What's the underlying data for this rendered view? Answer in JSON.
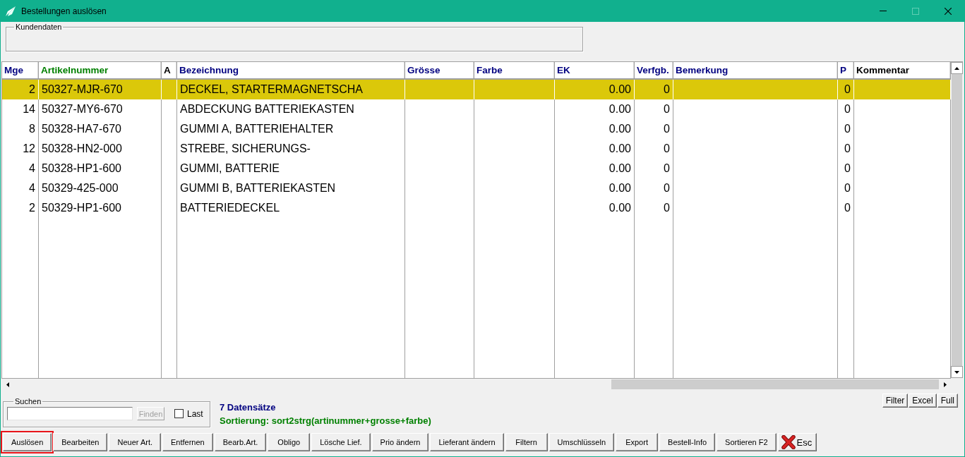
{
  "window": {
    "title": "Bestellungen auslösen",
    "controls": [
      {
        "kind": "minimize",
        "disabled": false
      },
      {
        "kind": "maximize",
        "disabled": true
      },
      {
        "kind": "close",
        "disabled": false
      }
    ]
  },
  "customer_group": {
    "label": "Kundendaten"
  },
  "table": {
    "columns": [
      {
        "label": "Mge",
        "kind": "number",
        "color": "#000080"
      },
      {
        "label": "Artikelnummer",
        "kind": "text",
        "color": "#008000"
      },
      {
        "label": "A",
        "kind": "text",
        "color": "#000000"
      },
      {
        "label": "Bezeichnung",
        "kind": "text",
        "color": "#000080"
      },
      {
        "label": "Grösse",
        "kind": "text",
        "color": "#000080"
      },
      {
        "label": "Farbe",
        "kind": "text",
        "color": "#000080"
      },
      {
        "label": "EK",
        "kind": "number",
        "color": "#000080"
      },
      {
        "label": "Verfgb.",
        "kind": "number",
        "color": "#000080"
      },
      {
        "label": "Bemerkung",
        "kind": "text",
        "color": "#000080"
      },
      {
        "label": "P",
        "kind": "number",
        "color": "#000080"
      },
      {
        "label": "Kommentar",
        "kind": "text",
        "color": "#000000"
      }
    ],
    "rows": [
      {
        "selected": true,
        "cells": [
          "2",
          "50327-MJR-670",
          null,
          "DECKEL, STARTERMAGNETSCHA",
          null,
          null,
          "0.00",
          "0",
          null,
          "0",
          null
        ]
      },
      {
        "selected": false,
        "cells": [
          "14",
          "50327-MY6-670",
          null,
          "ABDECKUNG BATTERIEKASTEN",
          null,
          null,
          "0.00",
          "0",
          null,
          "0",
          null
        ]
      },
      {
        "selected": false,
        "cells": [
          "8",
          "50328-HA7-670",
          null,
          "GUMMI A, BATTERIEHALTER",
          null,
          null,
          "0.00",
          "0",
          null,
          "0",
          null
        ]
      },
      {
        "selected": false,
        "cells": [
          "12",
          "50328-HN2-000",
          null,
          "STREBE, SICHERUNGS-",
          null,
          null,
          "0.00",
          "0",
          null,
          "0",
          null
        ]
      },
      {
        "selected": false,
        "cells": [
          "4",
          "50328-HP1-600",
          null,
          "GUMMI, BATTERIE",
          null,
          null,
          "0.00",
          "0",
          null,
          "0",
          null
        ]
      },
      {
        "selected": false,
        "cells": [
          "4",
          "50329-425-000",
          null,
          "GUMMI B, BATTERIEKASTEN",
          null,
          null,
          "0.00",
          "0",
          null,
          "0",
          null
        ]
      },
      {
        "selected": false,
        "cells": [
          "2",
          "50329-HP1-600",
          null,
          "BATTERIEDECKEL",
          null,
          null,
          "0.00",
          "0",
          null,
          "0",
          null
        ]
      }
    ]
  },
  "search": {
    "label": "Suchen",
    "button": {
      "label": "Finden",
      "disabled": true
    },
    "checkbox": {
      "label": "Last",
      "checked": false
    }
  },
  "status": {
    "record_count": "7 Datensätze",
    "sorting": "Sortierung: sort2strg(artinummer+grosse+farbe)"
  },
  "view_buttons": [
    {
      "label": "Filter"
    },
    {
      "label": "Excel"
    },
    {
      "label": "Full"
    }
  ],
  "action_buttons": [
    {
      "kind": "text",
      "label": "Auslösen",
      "focused": true
    },
    {
      "kind": "text",
      "label": "Bearbeiten",
      "focused": false
    },
    {
      "kind": "text",
      "label": "Neuer Art.",
      "focused": false
    },
    {
      "kind": "text",
      "label": "Entfernen",
      "focused": false
    },
    {
      "kind": "text",
      "label": "Bearb.Art.",
      "focused": false
    },
    {
      "kind": "text",
      "label": "Obligo",
      "focused": false
    },
    {
      "kind": "text",
      "label": "Lösche Lief.",
      "focused": false
    },
    {
      "kind": "text",
      "label": "Prio ändern",
      "focused": false
    },
    {
      "kind": "text",
      "label": "Lieferant ändern",
      "focused": false
    },
    {
      "kind": "text",
      "label": "Filtern",
      "focused": false
    },
    {
      "kind": "text",
      "label": "Umschlüsseln",
      "focused": false
    },
    {
      "kind": "text",
      "label": "Export",
      "focused": false
    },
    {
      "kind": "text",
      "label": "Bestell-Info",
      "focused": false
    },
    {
      "kind": "text",
      "label": "Sortieren F2",
      "focused": false
    },
    {
      "kind": "exit",
      "label": "Esc",
      "focused": false
    }
  ]
}
